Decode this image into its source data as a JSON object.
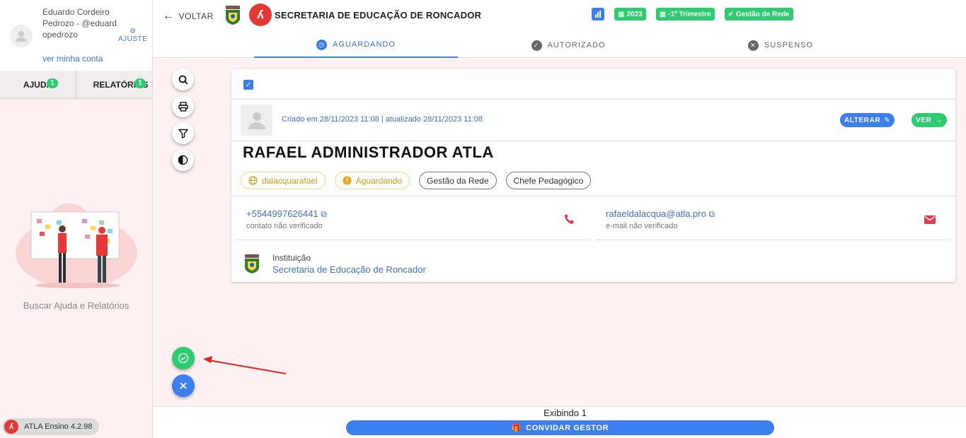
{
  "user": {
    "name": "Eduardo Cordeiro Pedrozo - @eduardopedrozo",
    "link": "ver minha conta",
    "settings_label": "AJUSTE"
  },
  "sidebar": {
    "tabs": [
      {
        "label": "AJUDA",
        "badge": "1"
      },
      {
        "label": "RELATÓRIOS",
        "badge": "1"
      }
    ],
    "help_caption": "Buscar Ajuda e Relatórios",
    "version": "ATLA Ensino 4.2.98"
  },
  "header": {
    "back_label": "VOLTAR",
    "org_title": "SECRETARIA DE EDUCAÇÃO DE RONCADOR",
    "logo_letter": "ʎ",
    "chips": [
      "2023",
      "-1º Trimestre",
      "Gestão de Rede"
    ],
    "status_tabs": [
      "AGUARDANDO",
      "AUTORIZADO",
      "SUSPENSO"
    ]
  },
  "card": {
    "created_text": "Criado em 28/11/2023 11:08 | atualizado 28/11/2023 11:08",
    "edit_label": "ALTERAR",
    "view_label": "VER",
    "person_name": "RAFAEL ADMINISTRADOR ATLA",
    "tags": [
      "dalacquarafael",
      "Aguardando",
      "Gestão da Rede",
      "Chefe Pedagógico"
    ],
    "phone": "+5544997626441",
    "phone_status": "contato não verificado",
    "email": "rafaeldalacqua@atla.pro",
    "email_status": "e-mail não verificado",
    "institution_label": "Instituição",
    "institution": "Secretaria de Educação de Roncador"
  },
  "footer": {
    "count_text": "Exibindo 1",
    "invite_label": "CONVIDAR GESTOR"
  },
  "colors": {
    "accent": "#3d7ef0",
    "success": "#2ecc71",
    "danger": "#e53935",
    "warning": "#d69b17"
  }
}
